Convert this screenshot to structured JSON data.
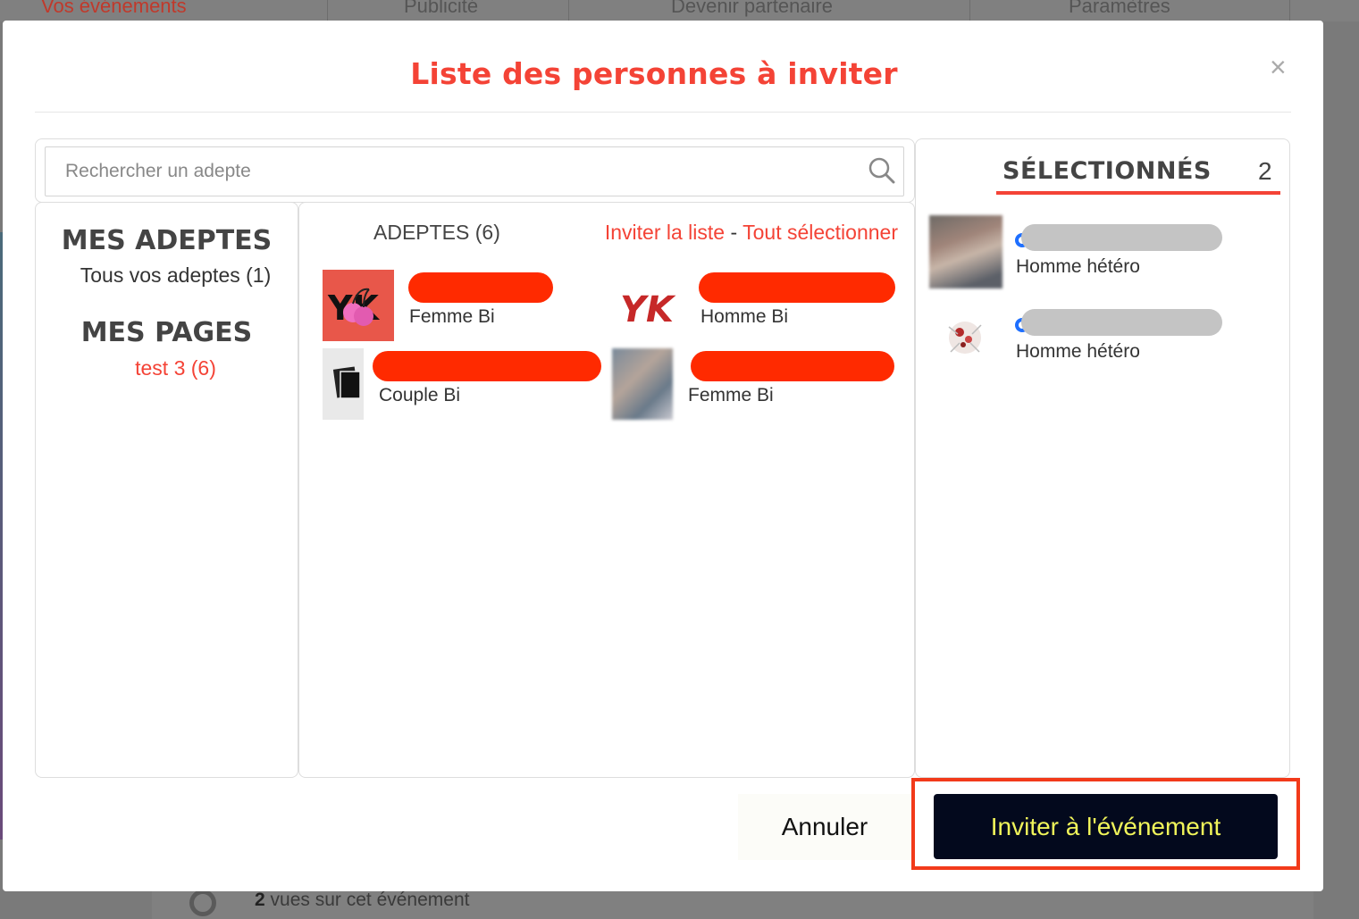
{
  "background": {
    "nav_tabs": [
      "Vos événements",
      "Publicité",
      "Devenir partenaire",
      "Paramètres"
    ],
    "footer_count": "2",
    "footer_text": " vues sur cet événement"
  },
  "modal": {
    "title": "Liste des personnes à inviter",
    "close_label": "×"
  },
  "search": {
    "placeholder": "Rechercher un adepte"
  },
  "left_panel": {
    "adepts_title": "MES ADEPTES",
    "adepts_all": "Tous vos adeptes (1)",
    "pages_title": "MES PAGES",
    "pages_items": [
      "test 3 (6)"
    ]
  },
  "mid_panel": {
    "header": "ADEPTES (6)",
    "invite_list": "Inviter la liste",
    "separator": " - ",
    "select_all": "Tout sélectionner",
    "adepts": [
      {
        "desc": "Femme Bi",
        "avatar": "logo-cherries"
      },
      {
        "desc": "Homme Bi",
        "avatar": "logo-yk"
      },
      {
        "desc": "Couple Bi",
        "avatar": "photos-stack"
      },
      {
        "desc": "Femme Bi",
        "avatar": "photo-blurred"
      }
    ]
  },
  "selected": {
    "title": "SÉLECTIONNÉS",
    "count": "2",
    "items": [
      {
        "desc": "Homme hétéro",
        "avatar": "photo-blurred"
      },
      {
        "desc": "Homme hétéro",
        "avatar": "flower-image"
      }
    ]
  },
  "actions": {
    "cancel": "Annuler",
    "invite": "Inviter à l'événement"
  },
  "colors": {
    "accent": "#f44336",
    "redaction": "#ff2a00",
    "invite_bg": "#03091d",
    "invite_text": "#f0f45a"
  }
}
